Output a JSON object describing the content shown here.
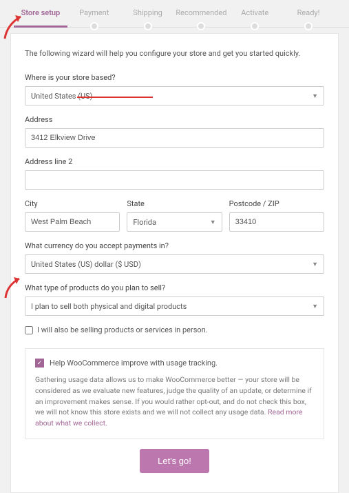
{
  "steps": [
    "Store setup",
    "Payment",
    "Shipping",
    "Recommended",
    "Activate",
    "Ready!"
  ],
  "activeStep": 0,
  "intro": "The following wizard will help you configure your store and get you started quickly.",
  "labels": {
    "storeBased": "Where is your store based?",
    "address": "Address",
    "address2": "Address line 2",
    "city": "City",
    "state": "State",
    "postcode": "Postcode / ZIP",
    "currency": "What currency do you accept payments in?",
    "productType": "What type of products do you plan to sell?",
    "inPerson": "I will also be selling products or services in person.",
    "trackingHead": "Help WooCommerce improve with usage tracking.",
    "trackingBody": "Gathering usage data allows us to make WooCommerce better — your store will be considered as we evaluate new features, judge the quality of an update, or determine if an improvement makes sense. If you would rather opt-out, and do not check this box, we will not know this store exists and we will not collect any usage data. ",
    "trackingLink": "Read more about what we collect.",
    "button": "Let's go!"
  },
  "values": {
    "country": "United States (US)",
    "address": "3412 Elkview Drive",
    "address2": "",
    "city": "West Palm Beach",
    "state": "Florida",
    "postcode": "33410",
    "currency": "United States (US) dollar ($ USD)",
    "productType": "I plan to sell both physical and digital products",
    "inPersonChecked": false,
    "trackingChecked": true
  }
}
